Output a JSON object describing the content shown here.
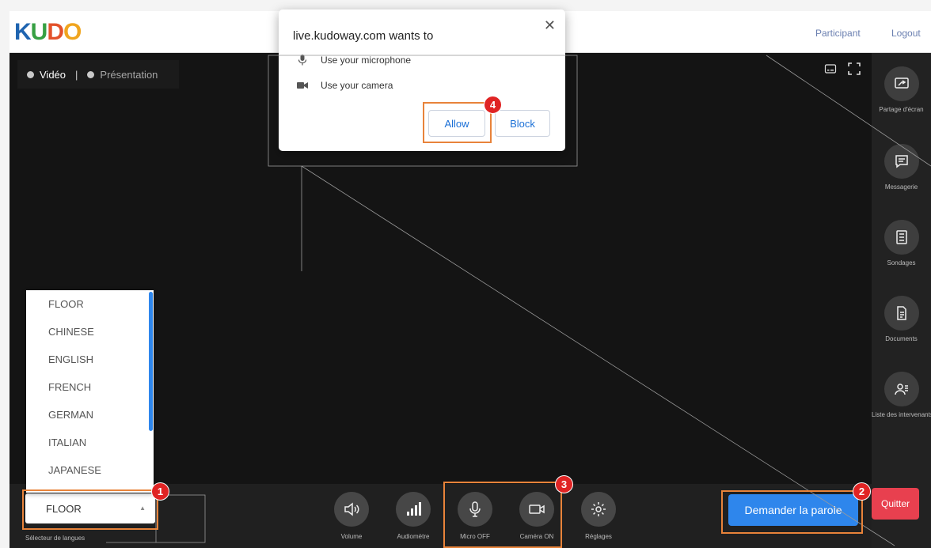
{
  "brand": {
    "letters": [
      "K",
      "U",
      "D",
      "O"
    ],
    "colors": [
      "#1f64b0",
      "#36a043",
      "#e3522b",
      "#f0a51f"
    ]
  },
  "header": {
    "participant_link": "Participant",
    "logout_link": "Logout"
  },
  "video": {
    "toggle_video": "Vidéo",
    "toggle_separator": "|",
    "toggle_presentation": "Présentation"
  },
  "sidebar": {
    "items": [
      {
        "label": "Partage d'écran",
        "icon": "screen-share-icon"
      },
      {
        "label": "Messagerie",
        "icon": "chat-icon"
      },
      {
        "label": "Sondages",
        "icon": "poll-icon"
      },
      {
        "label": "Documents",
        "icon": "document-icon"
      },
      {
        "label": "Liste des intervenants",
        "icon": "speakers-list-icon"
      }
    ]
  },
  "languages": {
    "selected": "FLOOR",
    "label": "Sélecteur de langues",
    "options": [
      "FLOOR",
      "CHINESE",
      "ENGLISH",
      "FRENCH",
      "GERMAN",
      "ITALIAN",
      "JAPANESE"
    ]
  },
  "controls": {
    "volume": "Volume",
    "audiometer": "Audiomètre",
    "micro": "Micro OFF",
    "camera": "Caméra ON",
    "settings": "Réglages"
  },
  "actions": {
    "request_floor": "Demander la parole",
    "quit": "Quitter"
  },
  "permission_dialog": {
    "title": "live.kudoway.com wants to",
    "close": "✕",
    "microphone": "Use your microphone",
    "camera": "Use your camera",
    "allow": "Allow",
    "block": "Block"
  },
  "callouts": [
    "1",
    "2",
    "3",
    "4"
  ],
  "colors": {
    "accent_blue": "#2e86ec",
    "quit_red": "#e8404f",
    "highlight_orange": "#e8833a",
    "badge_red": "#e02424"
  }
}
